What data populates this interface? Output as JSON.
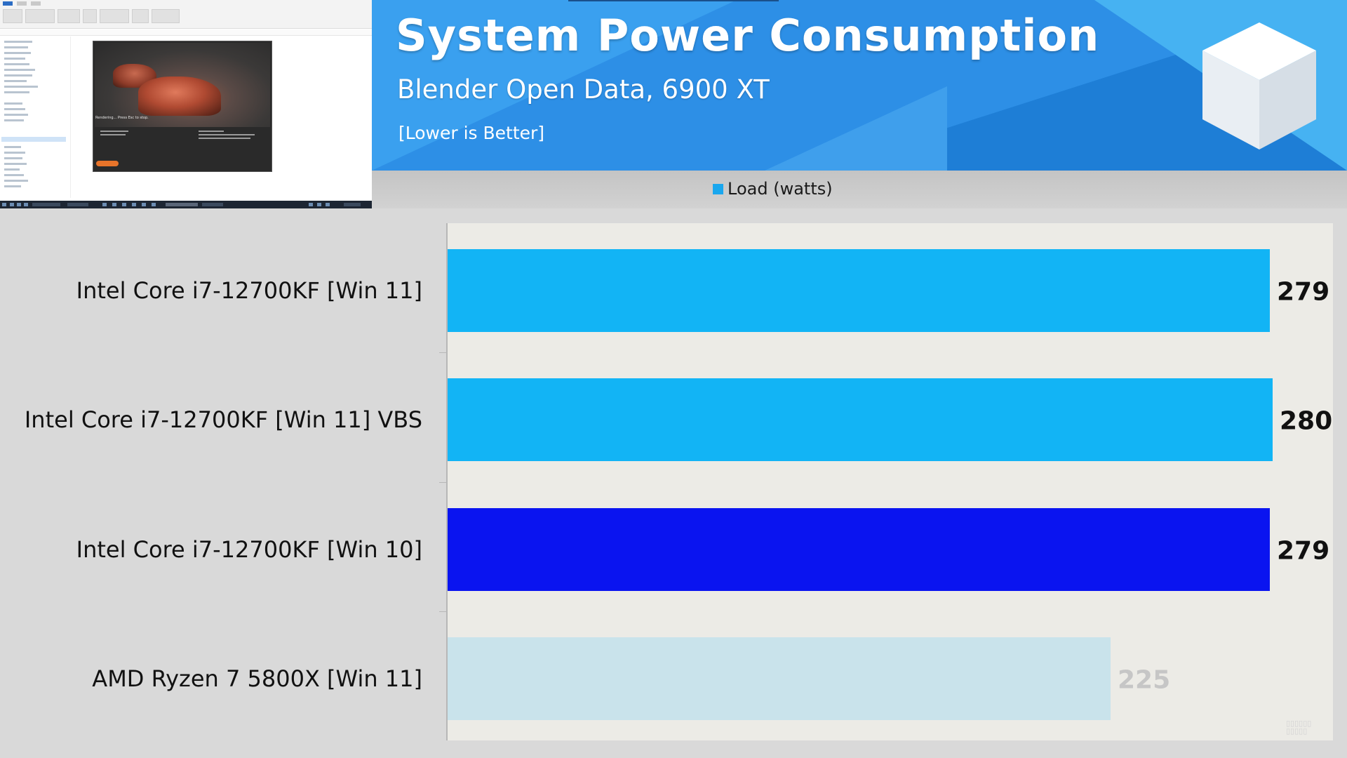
{
  "header": {
    "title": "System Power Consumption",
    "subtitle": "Blender Open Data, 6900 XT",
    "note": "[Lower is Better]"
  },
  "legend": {
    "label": "Load (watts)",
    "color": "#1aa7ee"
  },
  "thumbnail": {
    "status_text": "Rendering... Press Esc to stop."
  },
  "chart_data": {
    "type": "bar",
    "orientation": "horizontal",
    "title": "System Power Consumption",
    "subtitle": "Blender Open Data, 6900 XT",
    "note": "[Lower is Better]",
    "categories": [
      "Intel Core i7-12700KF [Win 11]",
      "Intel Core i7-12700KF [Win 11] VBS",
      "Intel Core i7-12700KF [Win 10]",
      "AMD Ryzen 7 5800X [Win 11]"
    ],
    "series": [
      {
        "name": "Load (watts)",
        "values": [
          279,
          280,
          279,
          225
        ],
        "colors": [
          "#12b4f5",
          "#12b4f5",
          "#0a14f0",
          "#c6e2ec"
        ]
      }
    ],
    "value_labels": [
      "279",
      "280",
      "279",
      "225"
    ],
    "xlim": [
      0,
      280
    ],
    "grid": false,
    "legend_position": "top"
  }
}
